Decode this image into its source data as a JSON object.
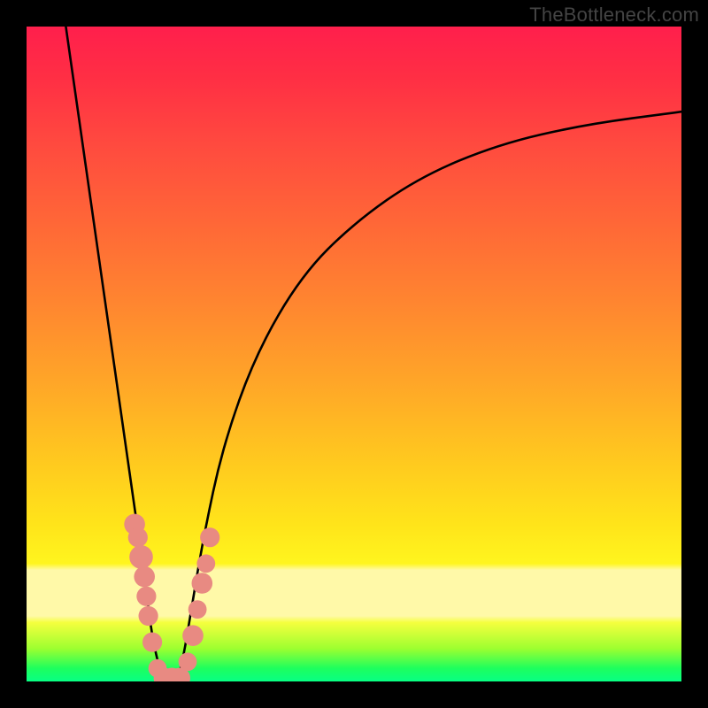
{
  "watermark": "TheBottleneck.com",
  "chart_data": {
    "type": "line",
    "title": "",
    "xlabel": "",
    "ylabel": "",
    "xlim": [
      0,
      100
    ],
    "ylim": [
      0,
      100
    ],
    "background_gradient_stops": [
      {
        "pos": 0,
        "color": "#ff1f4c"
      },
      {
        "pos": 30,
        "color": "#ff6737"
      },
      {
        "pos": 66,
        "color": "#ffc81f"
      },
      {
        "pos": 82,
        "color": "#fff51e"
      },
      {
        "pos": 83,
        "color": "#fff9a8"
      },
      {
        "pos": 90,
        "color": "#fff9a8"
      },
      {
        "pos": 95,
        "color": "#9cff30"
      },
      {
        "pos": 100,
        "color": "#08ff84"
      }
    ],
    "pale_band_y": [
      83,
      90
    ],
    "series": [
      {
        "name": "left-branch",
        "x": [
          6,
          8,
          10,
          12,
          14,
          16,
          18,
          19,
          20,
          21
        ],
        "y": [
          100,
          86,
          72,
          58,
          44,
          30,
          16,
          8,
          3,
          0
        ]
      },
      {
        "name": "right-branch",
        "x": [
          23,
          24,
          25,
          27,
          30,
          35,
          42,
          50,
          60,
          72,
          85,
          100
        ],
        "y": [
          0,
          4,
          10,
          22,
          36,
          50,
          62,
          70,
          77,
          82,
          85,
          87
        ]
      }
    ],
    "scatter": {
      "name": "beads",
      "color": "#e88a82",
      "points": [
        {
          "x": 16.5,
          "y": 24,
          "r": 1.6
        },
        {
          "x": 17.0,
          "y": 22,
          "r": 1.5
        },
        {
          "x": 17.5,
          "y": 19,
          "r": 1.8
        },
        {
          "x": 18.0,
          "y": 16,
          "r": 1.6
        },
        {
          "x": 18.3,
          "y": 13,
          "r": 1.5
        },
        {
          "x": 18.6,
          "y": 10,
          "r": 1.5
        },
        {
          "x": 19.2,
          "y": 6,
          "r": 1.5
        },
        {
          "x": 20.0,
          "y": 2,
          "r": 1.4
        },
        {
          "x": 21.0,
          "y": 0.5,
          "r": 1.6
        },
        {
          "x": 22.2,
          "y": 0.5,
          "r": 1.6
        },
        {
          "x": 23.4,
          "y": 0.5,
          "r": 1.6
        },
        {
          "x": 24.6,
          "y": 3,
          "r": 1.4
        },
        {
          "x": 25.4,
          "y": 7,
          "r": 1.6
        },
        {
          "x": 26.1,
          "y": 11,
          "r": 1.4
        },
        {
          "x": 26.8,
          "y": 15,
          "r": 1.6
        },
        {
          "x": 27.4,
          "y": 18,
          "r": 1.4
        },
        {
          "x": 28.0,
          "y": 22,
          "r": 1.5
        }
      ]
    },
    "valley_x": 22
  }
}
